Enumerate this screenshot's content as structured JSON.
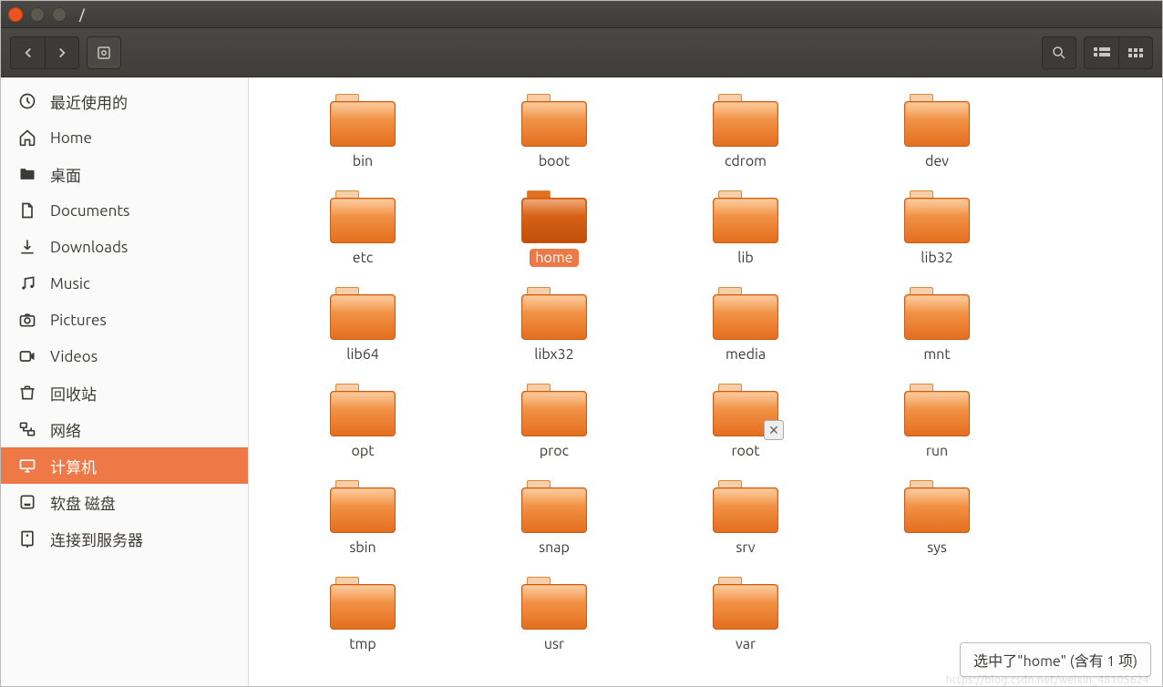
{
  "window": {
    "title": "/"
  },
  "toolbar": {
    "path_segment": "/"
  },
  "sidebar": {
    "items": [
      {
        "icon": "clock",
        "label": "最近使用的",
        "selected": false
      },
      {
        "icon": "home",
        "label": "Home",
        "selected": false
      },
      {
        "icon": "folder",
        "label": "桌面",
        "selected": false
      },
      {
        "icon": "document",
        "label": "Documents",
        "selected": false
      },
      {
        "icon": "download",
        "label": "Downloads",
        "selected": false
      },
      {
        "icon": "music",
        "label": "Music",
        "selected": false
      },
      {
        "icon": "camera",
        "label": "Pictures",
        "selected": false
      },
      {
        "icon": "video",
        "label": "Videos",
        "selected": false
      },
      {
        "icon": "trash",
        "label": "回收站",
        "selected": false
      },
      {
        "icon": "network",
        "label": "网络",
        "selected": false
      },
      {
        "icon": "computer",
        "label": "计算机",
        "selected": true
      },
      {
        "icon": "disk",
        "label": "软盘 磁盘",
        "selected": false
      },
      {
        "icon": "server",
        "label": "连接到服务器",
        "selected": false
      }
    ]
  },
  "folders": [
    {
      "name": "bin"
    },
    {
      "name": "boot"
    },
    {
      "name": "cdrom"
    },
    {
      "name": "dev"
    },
    {
      "name": "etc"
    },
    {
      "name": "home",
      "selected": true
    },
    {
      "name": "lib"
    },
    {
      "name": "lib32"
    },
    {
      "name": "lib64"
    },
    {
      "name": "libx32"
    },
    {
      "name": "media"
    },
    {
      "name": "mnt"
    },
    {
      "name": "opt"
    },
    {
      "name": "proc"
    },
    {
      "name": "root",
      "locked": true
    },
    {
      "name": "run"
    },
    {
      "name": "sbin"
    },
    {
      "name": "snap"
    },
    {
      "name": "srv"
    },
    {
      "name": "sys"
    },
    {
      "name": "tmp"
    },
    {
      "name": "usr"
    },
    {
      "name": "var"
    }
  ],
  "status": {
    "text": "选中了\"home\" (含有 1 项)"
  },
  "watermark": "https://blog.csdn.net/weixin_48105624"
}
